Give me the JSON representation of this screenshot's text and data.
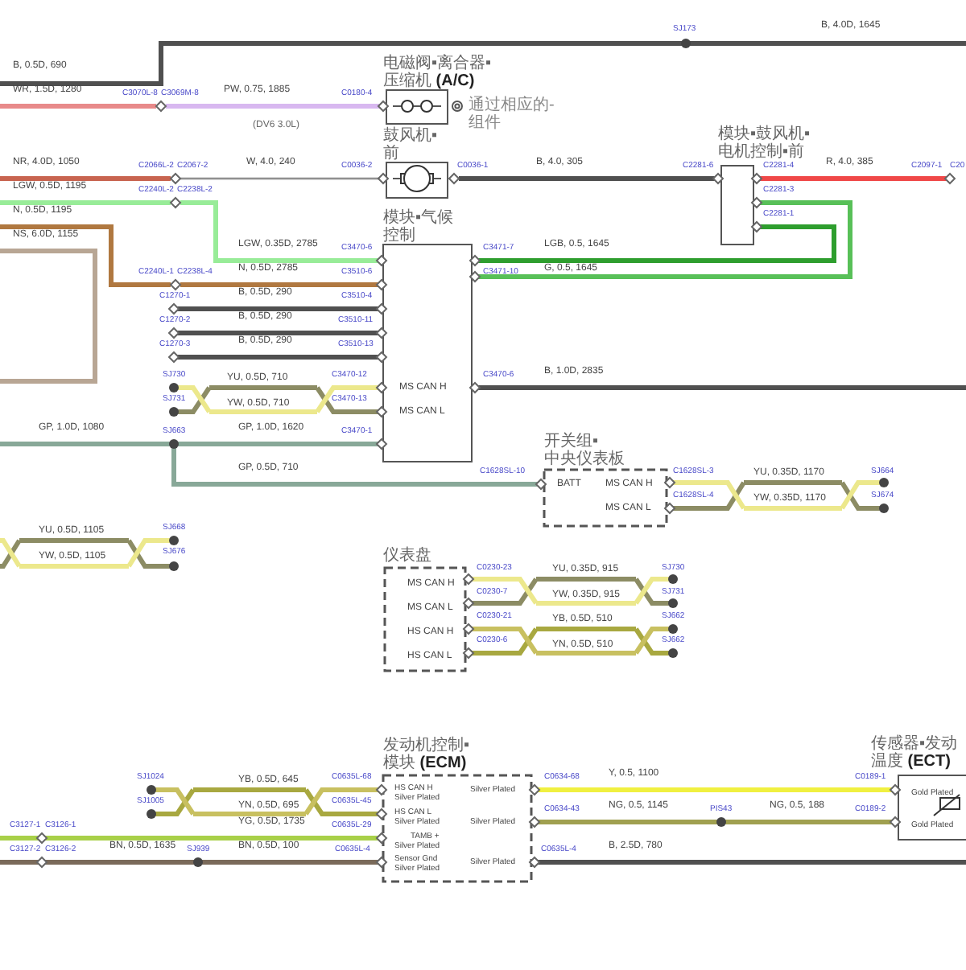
{
  "wires": [
    {
      "label": "B, 4.0D, 1645",
      "color": "#505050"
    },
    {
      "label": "B, 0.5D, 690",
      "color": "#505050"
    },
    {
      "label": "WR, 1.5D, 1280",
      "color": "#e88a8a"
    },
    {
      "label": "PW, 0.75, 1885",
      "color": "#d8b8f0"
    },
    {
      "label": "NR, 4.0D, 1050",
      "color": "#c86450"
    },
    {
      "label": "W, 4.0, 240",
      "color": "#909090"
    },
    {
      "label": "B, 4.0, 305",
      "color": "#505050"
    },
    {
      "label": "R, 4.0, 385",
      "color": "#f04848"
    },
    {
      "label": "LGW, 0.5D, 1195",
      "color": "#98ec98"
    },
    {
      "label": "N, 0.5D, 1195",
      "color": "#b07840"
    },
    {
      "label": "NS, 6.0D, 1155",
      "color": "#b8a694"
    },
    {
      "label": "LGW, 0.35D, 2785",
      "color": "#98ec98"
    },
    {
      "label": "LGB, 0.5, 1645",
      "color": "#2e9e2e"
    },
    {
      "label": "N, 0.5D, 2785",
      "color": "#b07840"
    },
    {
      "label": "G, 0.5, 1645",
      "color": "#58c058"
    },
    {
      "label": "B, 0.5D, 290",
      "color": "#505050"
    },
    {
      "label": "B, 0.5D, 290",
      "color": "#505050"
    },
    {
      "label": "B, 0.5D, 290",
      "color": "#505050"
    },
    {
      "label": "B, 1.0D, 2835",
      "color": "#505050"
    },
    {
      "label": "GP, 1.0D, 1080",
      "color": "#88a898"
    },
    {
      "label": "GP, 1.0D, 1620",
      "color": "#88a898"
    },
    {
      "label": "GP, 0.5D, 710",
      "color": "#88a898"
    },
    {
      "label": "YG, 0.5D, 1735",
      "color": "#a8d048"
    },
    {
      "label": "Y, 0.5, 1100",
      "color": "#f0f040"
    },
    {
      "label": "NG, 0.5, 1145",
      "color": "#a0a050"
    },
    {
      "label": "NG, 0.5, 188",
      "color": "#a0a050"
    },
    {
      "label": "BN, 0.5D, 1635",
      "color": "#7a6a5a"
    },
    {
      "label": "BN, 0.5D, 100",
      "color": "#7a6a5a"
    },
    {
      "label": "B, 2.5D, 780",
      "color": "#505050"
    }
  ],
  "twisted_pairs": [
    {
      "wires": [
        {
          "label": "YU, 0.5D, 710",
          "color": "#8c8c64"
        },
        {
          "label": "YW, 0.5D, 710",
          "color": "#ece88c"
        }
      ]
    },
    {
      "wires": [
        {
          "label": "YU, 0.35D, 1170",
          "color": "#8c8c64"
        },
        {
          "label": "YW, 0.35D, 1170",
          "color": "#ece88c"
        }
      ]
    },
    {
      "wires": [
        {
          "label": "YU, 0.5D, 1105",
          "color": "#8c8c64"
        },
        {
          "label": "YW, 0.5D, 1105",
          "color": "#ece88c"
        }
      ]
    },
    {
      "wires": [
        {
          "label": "YU, 0.35D, 915",
          "color": "#8c8c64"
        },
        {
          "label": "YW, 0.35D, 915",
          "color": "#ece88c"
        }
      ]
    },
    {
      "wires": [
        {
          "label": "YB, 0.5D, 510",
          "color": "#a8a840"
        },
        {
          "label": "YN, 0.5D, 510",
          "color": "#c8c060"
        }
      ]
    },
    {
      "wires": [
        {
          "label": "YB, 0.5D, 645",
          "color": "#a8a840"
        },
        {
          "label": "YN, 0.5D, 695",
          "color": "#c8c060"
        }
      ]
    }
  ],
  "points": [
    {
      "label": "SJ173",
      "kind": "splice"
    },
    {
      "label": "C3070L-8",
      "kind": "connector"
    },
    {
      "label": "C3069M-8",
      "kind": "connector"
    },
    {
      "label": "C0180-4",
      "kind": "connector"
    },
    {
      "label": "C2066L-2",
      "kind": "connector"
    },
    {
      "label": "C2067-2",
      "kind": "connector"
    },
    {
      "label": "C0036-2",
      "kind": "connector"
    },
    {
      "label": "C0036-1",
      "kind": "connector"
    },
    {
      "label": "C2281-6",
      "kind": "connector"
    },
    {
      "label": "C2281-4",
      "kind": "connector"
    },
    {
      "label": "C2097-1",
      "kind": "connector"
    },
    {
      "label": "C20",
      "kind": "connector"
    },
    {
      "label": "C2240L-2",
      "kind": "connector"
    },
    {
      "label": "C2238L-2",
      "kind": "connector"
    },
    {
      "label": "C2281-3",
      "kind": "connector"
    },
    {
      "label": "C2281-1",
      "kind": "connector"
    },
    {
      "label": "C3470-6",
      "kind": "connector"
    },
    {
      "label": "C3471-7",
      "kind": "connector"
    },
    {
      "label": "C2240L-1",
      "kind": "connector"
    },
    {
      "label": "C2238L-4",
      "kind": "connector"
    },
    {
      "label": "C3510-6",
      "kind": "connector"
    },
    {
      "label": "C3471-10",
      "kind": "connector"
    },
    {
      "label": "C1270-1",
      "kind": "connector"
    },
    {
      "label": "C3510-4",
      "kind": "connector"
    },
    {
      "label": "C1270-2",
      "kind": "connector"
    },
    {
      "label": "C3510-11",
      "kind": "connector"
    },
    {
      "label": "C1270-3",
      "kind": "connector"
    },
    {
      "label": "C3510-13",
      "kind": "connector"
    },
    {
      "label": "SJ730",
      "kind": "splice"
    },
    {
      "label": "C3470-12",
      "kind": "connector"
    },
    {
      "label": "C3470-6",
      "kind": "connector"
    },
    {
      "label": "SJ731",
      "kind": "splice"
    },
    {
      "label": "C3470-13",
      "kind": "connector"
    },
    {
      "label": "SJ663",
      "kind": "splice"
    },
    {
      "label": "C3470-1",
      "kind": "connector"
    },
    {
      "label": "C1628SL-10",
      "kind": "connector"
    },
    {
      "label": "C1628SL-3",
      "kind": "connector"
    },
    {
      "label": "SJ664",
      "kind": "splice"
    },
    {
      "label": "C1628SL-4",
      "kind": "connector"
    },
    {
      "label": "SJ674",
      "kind": "splice"
    },
    {
      "label": "SJ668",
      "kind": "splice"
    },
    {
      "label": "SJ676",
      "kind": "splice"
    },
    {
      "label": "C0230-23",
      "kind": "connector"
    },
    {
      "label": "SJ730",
      "kind": "splice"
    },
    {
      "label": "C0230-7",
      "kind": "connector"
    },
    {
      "label": "SJ731",
      "kind": "splice"
    },
    {
      "label": "C0230-21",
      "kind": "connector"
    },
    {
      "label": "SJ662",
      "kind": "splice"
    },
    {
      "label": "C0230-6",
      "kind": "connector"
    },
    {
      "label": "SJ662",
      "kind": "splice"
    },
    {
      "label": "SJ1024",
      "kind": "splice"
    },
    {
      "label": "C0635L-68",
      "kind": "connector"
    },
    {
      "label": "C0634-68",
      "kind": "connector"
    },
    {
      "label": "C0189-1",
      "kind": "connector"
    },
    {
      "label": "SJ1005",
      "kind": "splice"
    },
    {
      "label": "C0635L-45",
      "kind": "connector"
    },
    {
      "label": "C0634-43",
      "kind": "connector"
    },
    {
      "label": "PIS43",
      "kind": "splice"
    },
    {
      "label": "C0189-2",
      "kind": "connector"
    },
    {
      "label": "C3127-1",
      "kind": "connector"
    },
    {
      "label": "C3126-1",
      "kind": "connector"
    },
    {
      "label": "C0635L-29",
      "kind": "connector"
    },
    {
      "label": "C3127-2",
      "kind": "connector"
    },
    {
      "label": "C3126-2",
      "kind": "connector"
    },
    {
      "label": "SJ939",
      "kind": "splice"
    },
    {
      "label": "C0635L-4",
      "kind": "connector"
    },
    {
      "label": "C0635L-4",
      "kind": "connector"
    }
  ],
  "modules": [
    {
      "title": [
        "电磁阀▪离合器▪",
        "压缩机 **(A/C)**"
      ],
      "kind": "solid"
    },
    {
      "title": [
        "鼓风机▪",
        "前"
      ],
      "kind": "solid"
    },
    {
      "title": [
        "模块▪鼓风机▪",
        "电机控制▪前"
      ],
      "kind": "solid"
    },
    {
      "title": [
        "模块▪气候",
        "控制"
      ],
      "kind": "solid",
      "pins": [
        "MS CAN H",
        "MS CAN L"
      ]
    },
    {
      "title": [
        "开关组▪",
        "中央仪表板"
      ],
      "kind": "dashed",
      "pins": [
        "BATT",
        "MS CAN H",
        "MS CAN L"
      ]
    },
    {
      "title": [
        "仪表盘"
      ],
      "kind": "dashed",
      "pins": [
        "MS CAN H",
        "MS CAN L",
        "HS CAN H",
        "HS CAN L"
      ]
    },
    {
      "title": [
        "发动机控制▪",
        "模块 **(ECM)**"
      ],
      "kind": "dashed",
      "pins": [
        "HS CAN H",
        "Silver Plated",
        "HS CAN L",
        "Silver Plated",
        "TAMB +",
        "Silver Plated",
        "Sensor Gnd",
        "Silver Plated",
        "Silver Plated",
        "Silver Plated",
        "Silver Plated"
      ]
    },
    {
      "title": [
        "传感器▪发动",
        "温度 **(ECT)**"
      ],
      "kind": "solid",
      "pins": [
        "Gold Plated",
        "Gold Plated"
      ]
    }
  ],
  "notes": [
    "(DV6 3.0L)",
    "通过相应的-",
    "组件"
  ]
}
